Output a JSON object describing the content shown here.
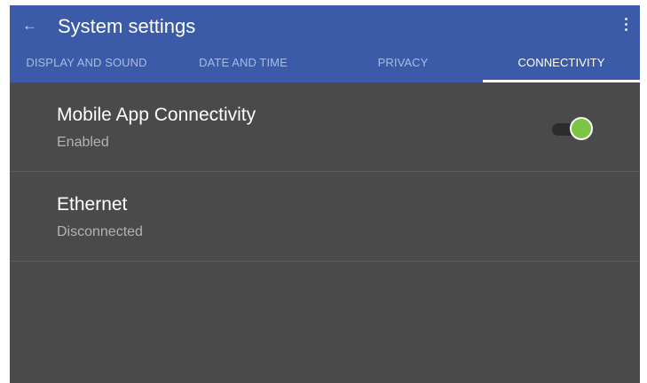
{
  "app_bar": {
    "back_icon": "arrow-left-icon",
    "title": "System settings",
    "overflow_icon": "more-vertical-icon"
  },
  "tabs": [
    {
      "label": "DISPLAY AND SOUND",
      "active": false
    },
    {
      "label": "DATE AND TIME",
      "active": false
    },
    {
      "label": "PRIVACY",
      "active": false
    },
    {
      "label": "CONNECTIVITY",
      "active": true
    }
  ],
  "settings": [
    {
      "title": "Mobile App Connectivity",
      "status": "Enabled",
      "toggle_on": true
    },
    {
      "title": "Ethernet",
      "status": "Disconnected"
    }
  ],
  "colors": {
    "app_bar": "#3b5ba9",
    "background": "#4a4a4a",
    "toggle_on": "#7cc443",
    "tab_inactive": "#a9bbe5",
    "tab_active": "#ffffff"
  }
}
